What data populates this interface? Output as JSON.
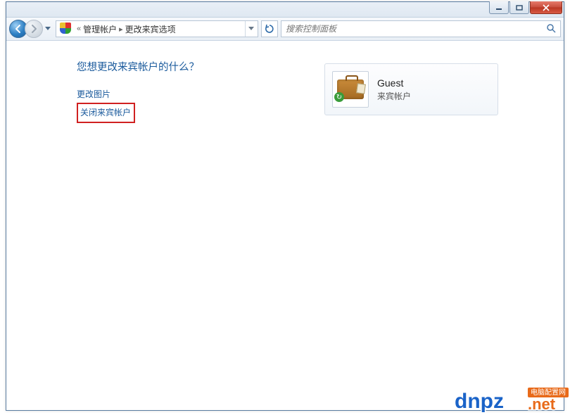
{
  "breadcrumb": {
    "prefix": "«",
    "seg1": "管理帐户",
    "seg2": "更改来宾选项"
  },
  "search": {
    "placeholder": "搜索控制面板"
  },
  "page": {
    "heading": "您想更改来宾帐户的什么？",
    "link_change_picture": "更改图片",
    "link_turn_off_guest": "关闭来宾帐户"
  },
  "account": {
    "name": "Guest",
    "type": "来宾帐户"
  },
  "icons": {
    "back": "back-arrow",
    "forward": "forward-arrow",
    "refresh": "refresh",
    "search": "search",
    "account": "briefcase-guest"
  },
  "watermark": {
    "text1": "dnpz",
    "text2": ".net",
    "badge": "电脑配置网"
  }
}
